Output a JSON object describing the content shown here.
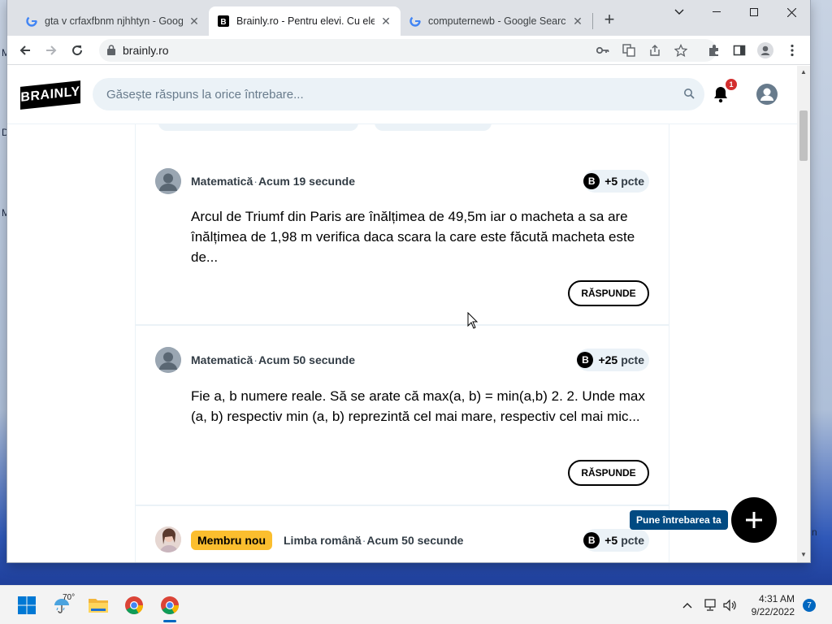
{
  "browser": {
    "tabs": [
      {
        "title": "gta v crfaxfbnm njhhtyn - Google",
        "favicon": "google-icon",
        "active": false
      },
      {
        "title": "Brainly.ro - Pentru elevi. Cu elevi.",
        "favicon": "brainly-icon",
        "active": true
      },
      {
        "title": "computernewb - Google Search",
        "favicon": "google-icon",
        "active": false
      }
    ],
    "close_glyph": "✕",
    "new_tab_glyph": "+",
    "url": "brainly.ro"
  },
  "site": {
    "logo_text": "BRAINLY",
    "search_placeholder": "Găsește răspuns la orice întrebare...",
    "notification_count": "1"
  },
  "questions": [
    {
      "subject": "Matematică",
      "time": "Acum 19 secunde",
      "points": "+5",
      "points_unit": "pcte",
      "text": "Arcul de Triumf din Paris are înălțimea de 49,5m iar o macheta a sa are înălțimea de 1,98 m verifica daca scara la care este făcută macheta este de...",
      "answer_label": "RĂSPUNDE"
    },
    {
      "subject": "Matematică",
      "time": "Acum 50 secunde",
      "points": "+25",
      "points_unit": "pcte",
      "text": "Fie a, b numere reale. Să se arate că max(a, b) = min(a,b) 2. 2. Unde max (a, b) respectiv min (a, b) reprezintă cel mai mare, respectiv cel mai mic...",
      "answer_label": "RĂSPUNDE"
    },
    {
      "badge": "Membru nou",
      "subject": "Limba română",
      "time": "Acum 50 secunde",
      "points": "+5",
      "points_unit": "pcte"
    }
  ],
  "meta_separator": "·",
  "points_icon_letter": "B",
  "ask_button_label": "Pune întrebarea ta",
  "taskbar": {
    "weather_temp": "70°",
    "time": "4:31 AM",
    "date": "9/22/2022",
    "notification_count": "7"
  },
  "desktop_letters": [
    "M",
    "D",
    "M",
    "n"
  ],
  "colors": {
    "accent_blue": "#014a82",
    "new_member_yellow": "#fbbe2e",
    "search_bg": "#ebf2f7",
    "notification_red": "#d32f2f"
  }
}
